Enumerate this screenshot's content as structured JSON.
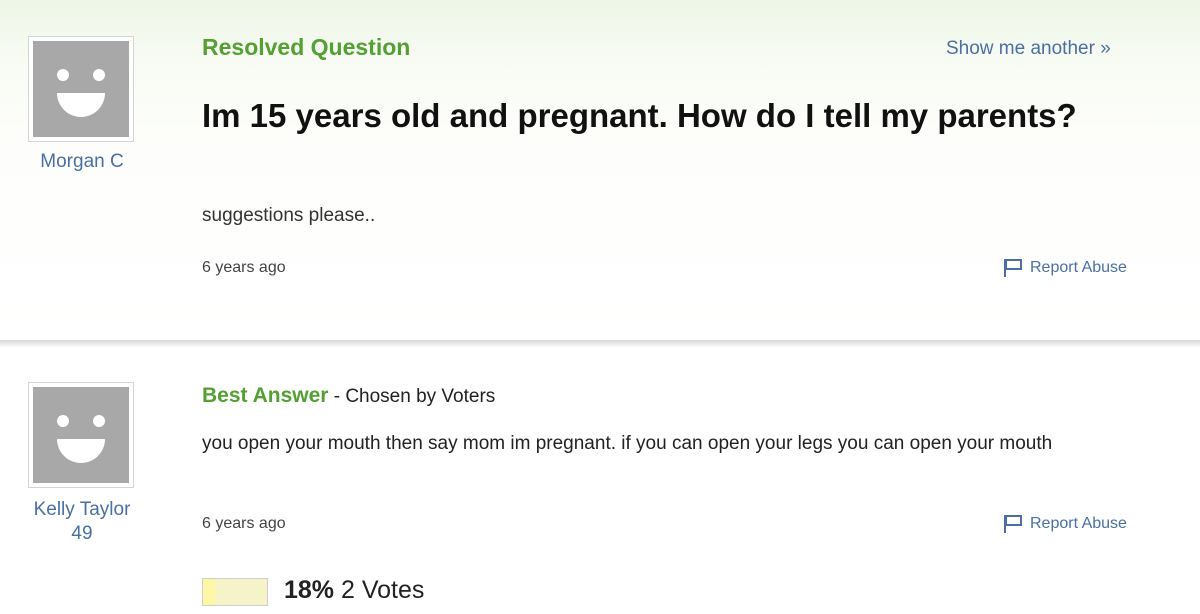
{
  "question": {
    "status_heading": "Resolved Question",
    "show_another": "Show me another »",
    "asker_name": "Morgan C",
    "title": "Im 15 years old and pregnant. How do I tell my parents?",
    "detail": "suggestions please..",
    "time_ago": "6 years ago",
    "report_label": "Report Abuse"
  },
  "best_answer": {
    "label": "Best Answer",
    "chosen_by": " - Chosen by Voters",
    "answerer_name": "Kelly Taylor",
    "answerer_points": "49",
    "text": "you open your mouth then say mom im pregnant. if you can open your legs you can open your mouth",
    "time_ago": "6 years ago",
    "report_label": "Report Abuse",
    "vote_percent": "18%",
    "vote_percent_value": 0.18,
    "vote_count": "2 Votes"
  },
  "icons": {
    "avatar": "default-avatar-smiley-icon",
    "report": "flag-icon"
  },
  "colors": {
    "link_blue": "#4a6fa5",
    "heading_green": "#54a033",
    "avatar_gray": "#a8a8a8",
    "vote_bar": "#fff7a6"
  }
}
